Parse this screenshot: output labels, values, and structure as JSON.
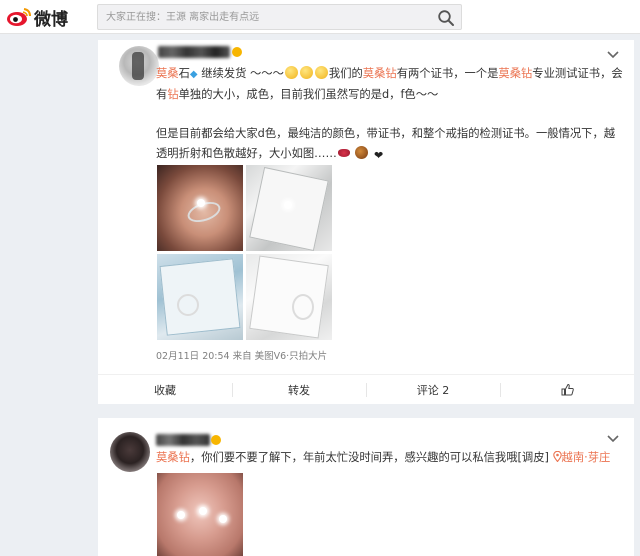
{
  "header": {
    "logo_text": "微博",
    "search_placeholder": "大家正在搜：王源 离家出走有点远"
  },
  "posts": [
    {
      "author_suffix_badge": "V",
      "text_line1": {
        "mention": "莫桑",
        "mention2": "石",
        "body_a": " 继续发货 ～～～",
        "body_b": "我们的",
        "hl1": "莫桑钻",
        "body_c": "有两个证书，一个是",
        "hl2": "莫桑钻",
        "body_d": "专业测试证书，会有",
        "hl3": "钻",
        "body_e": "单独的大小，成色，目前我们虽然写的是d，f色～～"
      },
      "text_line2": "但是目前都会给大家d色，最纯洁的颜色，带证书，和整个戒指的检测证书。一般情况下，越透明折射和色散越好，大小如图……",
      "meta": "02月11日 20:54 来自 美图V6·只拍大片",
      "actions": {
        "favorite": "收藏",
        "repost": "转发",
        "comment": "评论 2",
        "like_icon": "thumbs-up-icon"
      }
    },
    {
      "mention": "莫桑钻",
      "body": "，你们要不要了解下，年前太忙没时间弄，感兴趣的可以私信我哦[调皮]",
      "location": "越南·芽庄",
      "location_icon": "location-pin-icon"
    }
  ],
  "colors": {
    "accent": "#eb7350",
    "background": "#eceff3",
    "card": "#ffffff",
    "link": "#eb7350"
  }
}
